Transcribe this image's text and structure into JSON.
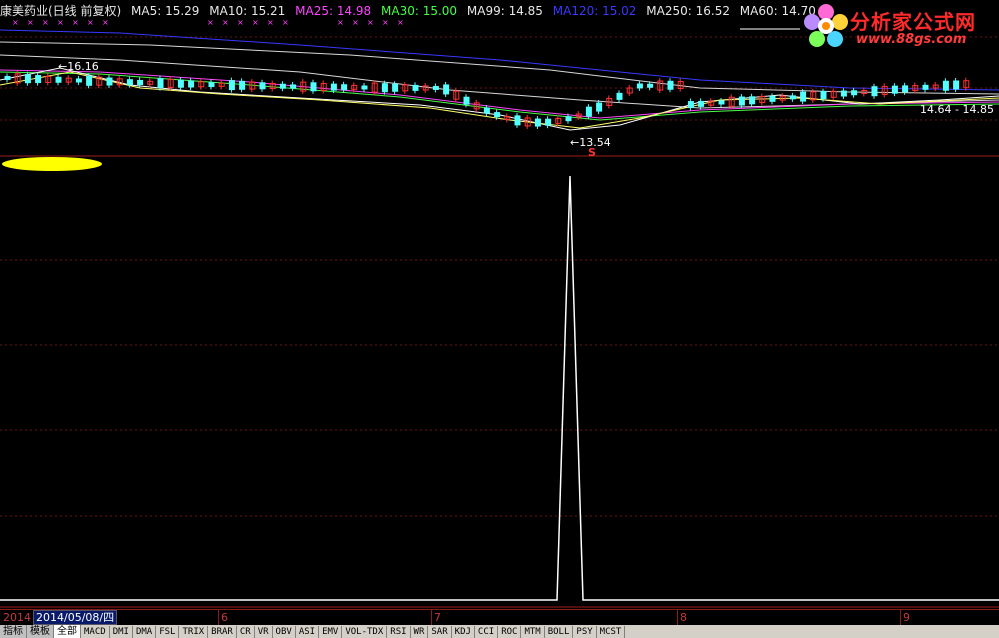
{
  "stock_title": "康美药业(日线 前复权)",
  "ma_labels": [
    {
      "text": "MA5: 15.29",
      "color": "#e8e8e8"
    },
    {
      "text": "MA10: 15.21",
      "color": "#e8e8e8"
    },
    {
      "text": "MA25: 14.98",
      "color": "#ff44ff"
    },
    {
      "text": "MA30: 15.00",
      "color": "#44ff44"
    },
    {
      "text": "MA99: 14.85",
      "color": "#e8e8e8"
    },
    {
      "text": "MA120: 15.02",
      "color": "#3838ff"
    },
    {
      "text": "MA250: 16.52",
      "color": "#e8e8e8"
    },
    {
      "text": "MA60: 14.70",
      "color": "#e8e8e8"
    }
  ],
  "price_annotations": {
    "high": "16.16",
    "low": "13.54",
    "right": "14.64 - 14.85",
    "signal_marker": "S"
  },
  "logo": {
    "title": "分析家公式网",
    "url": "www.88gs.com"
  },
  "date_bar": {
    "year": "2014",
    "current_date": "2014/05/08/四",
    "months": [
      "6",
      "7",
      "8",
      "9"
    ]
  },
  "tabs": {
    "categories": [
      "指标",
      "模板",
      "全部"
    ],
    "indicators": [
      "MACD",
      "DMI",
      "DMA",
      "FSL",
      "TRIX",
      "BRAR",
      "CR",
      "VR",
      "OBV",
      "ASI",
      "EMV",
      "VOL-TDX",
      "RSI",
      "WR",
      "SAR",
      "KDJ",
      "CCI",
      "ROC",
      "MTM",
      "BOLL",
      "PSY",
      "MCST"
    ],
    "active": "全部"
  },
  "colors": {
    "background": "#000000",
    "up_candle": "#ff3232",
    "down_candle": "#54ffff",
    "divider": "#a01e1e",
    "signal": "#ffffff",
    "highlight": "#ffff00"
  }
}
